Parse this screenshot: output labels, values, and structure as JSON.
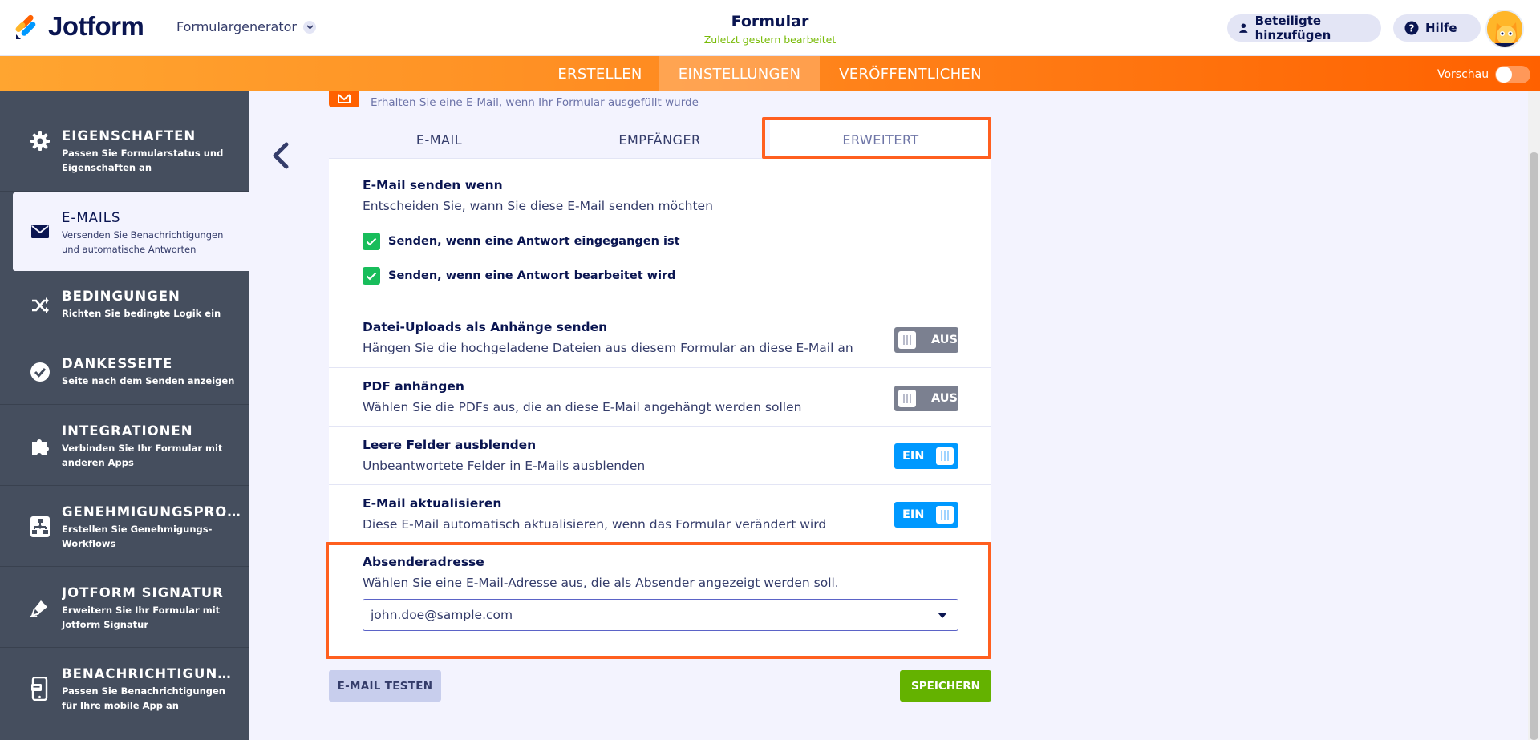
{
  "header": {
    "logo_text": "Jotform",
    "builder_label": "Formulargenerator",
    "form_title": "Formular",
    "form_subtitle": "Zuletzt gestern bearbeitet",
    "participants_label": "Beteiligte hinzufügen",
    "help_label": "Hilfe"
  },
  "nav": {
    "tabs": [
      {
        "label": "ERSTELLEN",
        "active": false
      },
      {
        "label": "EINSTELLUNGEN",
        "active": true
      },
      {
        "label": "VERÖFFENTLICHEN",
        "active": false
      }
    ],
    "preview_label": "Vorschau"
  },
  "sidebar": {
    "items": [
      {
        "title": "EIGENSCHAFTEN",
        "desc": "Passen Sie Formularstatus und Eigenschaften an",
        "icon": "gear-icon"
      },
      {
        "title": "E-MAILS",
        "desc": "Versenden Sie Benachrichtigungen und automatische Antworten",
        "icon": "envelope-icon",
        "active": true
      },
      {
        "title": "BEDINGUNGEN",
        "desc": "Richten Sie bedingte Logik ein",
        "icon": "shuffle-icon"
      },
      {
        "title": "DANKESSEITE",
        "desc": "Seite nach dem Senden anzeigen",
        "icon": "check-circle-icon"
      },
      {
        "title": "INTEGRATIONEN",
        "desc": "Verbinden Sie Ihr Formular mit anderen Apps",
        "icon": "puzzle-icon"
      },
      {
        "title": "GENEHMIGUNGSPROZE...",
        "desc": "Erstellen Sie Genehmigungs-Workflows",
        "icon": "flowchart-icon"
      },
      {
        "title": "JOTFORM SIGNATUR",
        "desc": "Erweitern Sie Ihr Formular mit Jotform Signatur",
        "icon": "pen-signature-icon"
      },
      {
        "title": "BENACHRICHTIGUNGEN",
        "desc": "Passen Sie Benachrichtigungen für Ihre mobile App an",
        "icon": "mobile-icon"
      }
    ]
  },
  "email_panel": {
    "header_desc": "Erhalten Sie eine E-Mail, wenn Ihr Formular ausgefüllt wurde",
    "tabs": [
      {
        "label": "E-MAIL"
      },
      {
        "label": "EMPFÄNGER"
      },
      {
        "label": "ERWEITERT",
        "active": true
      }
    ],
    "send_when": {
      "label": "E-Mail senden wenn",
      "desc": "Entscheiden Sie, wann Sie diese E-Mail senden möchten",
      "options": [
        {
          "label": "Senden, wenn eine Antwort eingegangen ist",
          "checked": true
        },
        {
          "label": "Senden, wenn eine Antwort bearbeitet wird",
          "checked": true
        }
      ]
    },
    "settings": [
      {
        "label": "Datei-Uploads als Anhänge senden",
        "desc": "Hängen Sie die hochgeladene Dateien aus diesem Formular an diese E-Mail an",
        "state": "AUS"
      },
      {
        "label": "PDF anhängen",
        "desc": "Wählen Sie die PDFs aus, die an diese E-Mail angehängt werden sollen",
        "state": "AUS"
      },
      {
        "label": "Leere Felder ausblenden",
        "desc": "Unbeantwortete Felder in E-Mails ausblenden",
        "state": "EIN"
      },
      {
        "label": "E-Mail aktualisieren",
        "desc": "Diese E-Mail automatisch aktualisieren, wenn das Formular verändert wird",
        "state": "EIN"
      }
    ],
    "sender": {
      "label": "Absenderadresse",
      "desc": "Wählen Sie eine E-Mail-Adresse aus, die als Absender angezeigt werden soll.",
      "value": "john.doe@sample.com"
    },
    "test_button": "E-MAIL TESTEN",
    "save_button": "SPEICHERN"
  },
  "colors": {
    "brand_orange": "#ff6100",
    "highlight_outline": "#ff5f1f",
    "sidebar_bg": "#454e5e",
    "toggle_on": "#0099ff",
    "toggle_off": "#7b8090",
    "checkbox": "#18bd5b",
    "save": "#64b200"
  }
}
